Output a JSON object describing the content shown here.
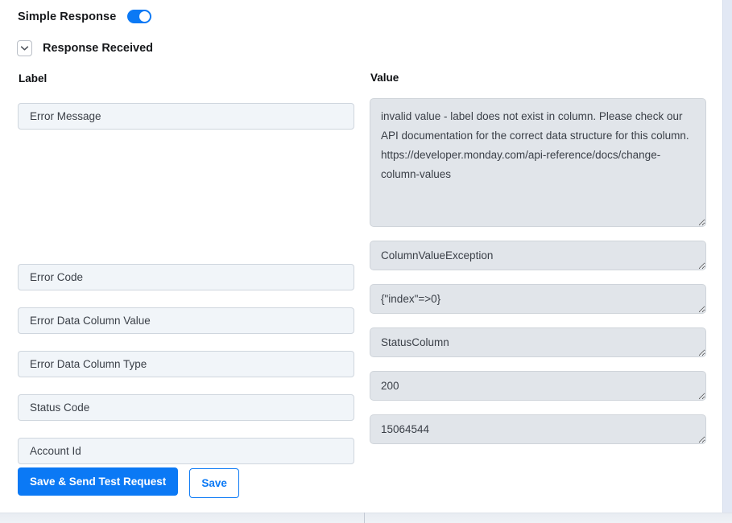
{
  "colors": {
    "accent": "#0b79f5",
    "label_field_bg": "#f1f5f9",
    "value_field_bg": "#e1e5ea",
    "text": "#3a3f47",
    "heading": "#17191c",
    "panel_edge": "#e2e8f4"
  },
  "header": {
    "simple_response_label": "Simple Response",
    "toggle_state": "on",
    "toggle_icon": "toggle-on-icon"
  },
  "section": {
    "title": "Response Received",
    "collapse_icon": "chevron-down-icon",
    "expanded": true
  },
  "columns": {
    "label_header": "Label",
    "value_header": "Value"
  },
  "rows": [
    {
      "label": "Error Message",
      "value": "invalid value - label does not exist in column. Please check our API documentation for the correct data structure for this column. https://developer.monday.com/api-reference/docs/change-column-values",
      "value_size": "big"
    },
    {
      "label": "Error Code",
      "value": "ColumnValueException",
      "value_size": "small"
    },
    {
      "label": "Error Data Column Value",
      "value": "{\"index\"=>0}",
      "value_size": "small"
    },
    {
      "label": "Error Data Column Type",
      "value": "StatusColumn",
      "value_size": "small"
    },
    {
      "label": "Status Code",
      "value": "200",
      "value_size": "small"
    },
    {
      "label": "Account Id",
      "value": "15064544",
      "value_size": "small"
    }
  ],
  "actions": {
    "primary_label": "Save & Send Test Request",
    "secondary_label": "Save"
  }
}
